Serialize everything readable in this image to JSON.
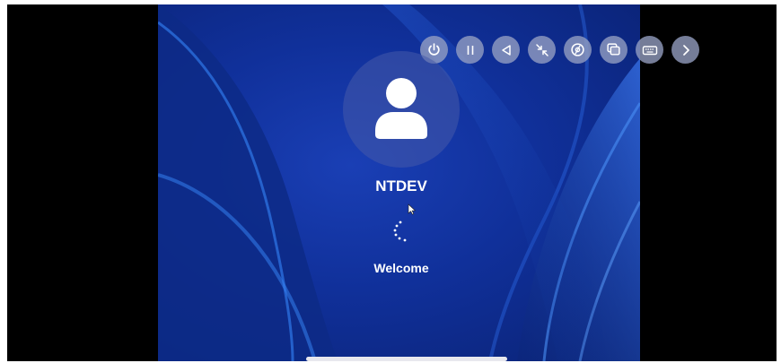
{
  "login": {
    "username": "NTDEV",
    "status": "Welcome"
  },
  "toolbar": {
    "buttons": [
      {
        "icon": "power-icon"
      },
      {
        "icon": "pause-icon"
      },
      {
        "icon": "back-triangle-icon"
      },
      {
        "icon": "shrink-icon"
      },
      {
        "icon": "disc-icon"
      },
      {
        "icon": "windows-overlap-icon"
      },
      {
        "icon": "keyboard-icon"
      },
      {
        "icon": "chevron-right-icon"
      }
    ]
  },
  "colors": {
    "wallpaper_base": "#10309a",
    "wallpaper_ribbon": "#1d58d8",
    "toolbar_button": "#969fc3",
    "text": "#ffffff"
  }
}
